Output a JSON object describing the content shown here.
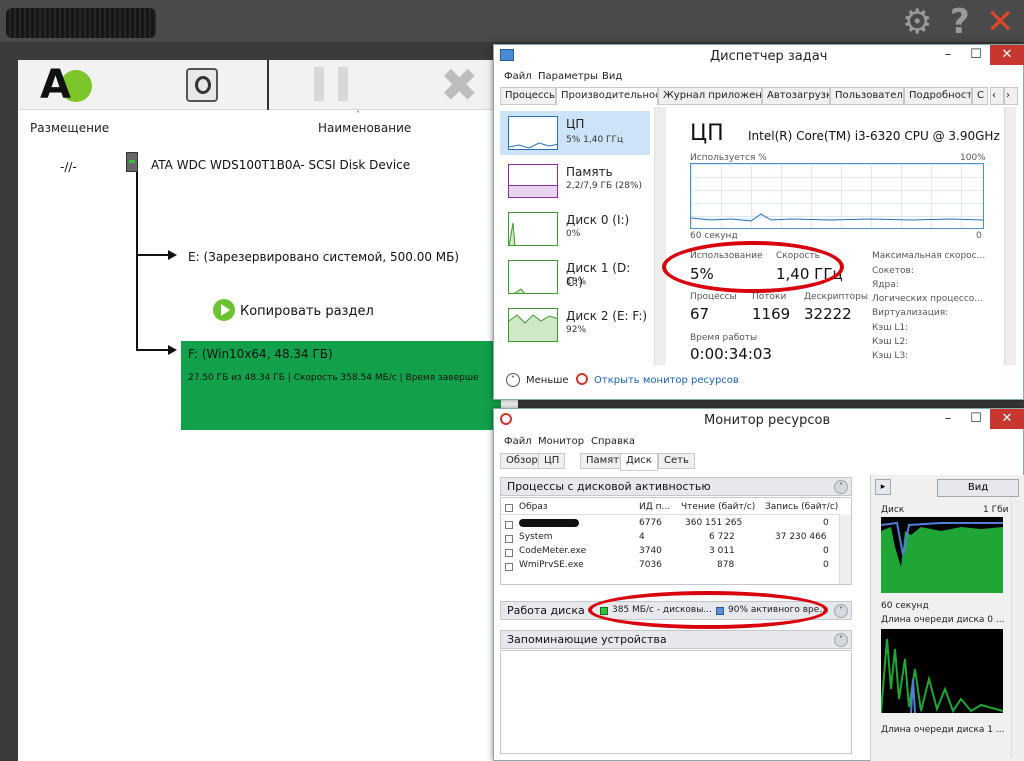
{
  "topbar": {
    "icons": [
      "gear-icon",
      "help-icon",
      "close-icon"
    ],
    "gear": "⚙",
    "help": "?",
    "close": "✕"
  },
  "app": {
    "columns": {
      "placement": "Размещение",
      "name": "Наименование"
    },
    "placement_value": "-//-",
    "disk": "ATA WDC WDS100T1B0A- SCSI Disk Device",
    "partition_e": "E: (Зарезервировано системой, 500.00 МБ)",
    "copy_action": "Копировать раздел",
    "partition_f": "F: (Win10x64, 48.34 ГБ)",
    "progress": "27.50 ГБ из 48.34 ГБ | Скорость 358.54 МБ/с | Время заверше",
    "logo_letter": "A",
    "accent": "#12a14a"
  },
  "taskmgr": {
    "title": "Диспетчер задач",
    "menu": [
      "Файл",
      "Параметры",
      "Вид"
    ],
    "tabs": [
      "Процессы",
      "Производительность",
      "Журнал приложений",
      "Автозагрузка",
      "Пользователи",
      "Подробности",
      "С"
    ],
    "active_tab": "Производительность",
    "sidebar": [
      {
        "name": "ЦП",
        "sub": "5% 1,40 ГГц"
      },
      {
        "name": "Память",
        "sub": "2,2/7,9 ГБ (28%)"
      },
      {
        "name": "Диск 0 (I:)",
        "sub": "0%"
      },
      {
        "name": "Диск 1 (D: C:)",
        "sub": "18%"
      },
      {
        "name": "Диск 2 (E: F:)",
        "sub": "92%"
      }
    ],
    "cpu_title": "ЦП",
    "cpu_model": "Intel(R) Core(TM) i3-6320 CPU @ 3.90GHz",
    "graph_label_left": "Используется %",
    "graph_label_right": "100%",
    "graph_time": "60 секунд",
    "graph_zero": "0",
    "usage_label": "Использование",
    "usage_value": "5%",
    "speed_label": "Скорость",
    "speed_value": "1,40 ГГц",
    "processes_label": "Процессы",
    "processes_value": "67",
    "threads_label": "Потоки",
    "threads_value": "1169",
    "handles_label": "Дескрипторы",
    "handles_value": "32222",
    "uptime_label": "Время работы",
    "uptime_value": "0:00:34:03",
    "right_labels": [
      "Максимальная скорос...",
      "Сокетов:",
      "Ядра:",
      "Логических процессо...",
      "Виртуализация:",
      "Кэш L1:",
      "Кэш L2:",
      "Кэш L3:"
    ],
    "less": "Меньше",
    "open_monitor": "Открыть монитор ресурсов"
  },
  "resmon": {
    "title": "Монитор ресурсов",
    "menu": [
      "Файл",
      "Монитор",
      "Справка"
    ],
    "tabs": [
      "Обзор",
      "ЦП",
      "Память",
      "Диск",
      "Сеть"
    ],
    "active_tab": "Диск",
    "disk_proc_header": "Процессы с дисковой активностью",
    "columns": [
      "Образ",
      "ИД п...",
      "Чтение (байт/с)",
      "Запись (байт/с)"
    ],
    "rows": [
      {
        "image": "",
        "pid": "6776",
        "read": "360 151 265",
        "write": "0"
      },
      {
        "image": "System",
        "pid": "4",
        "read": "6 722",
        "write": "37 230 466"
      },
      {
        "image": "CodeMeter.exe",
        "pid": "3740",
        "read": "3 011",
        "write": "0"
      },
      {
        "image": "WmiPrvSE.exe",
        "pid": "7036",
        "read": "878",
        "write": "0"
      }
    ],
    "disk_work_header": "Работа диска",
    "disk_work_a": "385 МБ/с - дисковы...",
    "disk_work_b": "90% активного вре...",
    "storage_header": "Запоминающие устройства",
    "view_button": "Вид",
    "disk_label": "Диск",
    "disk_rate": "1 Гби",
    "seconds": "60 секунд",
    "queue_a": "Длина очереди диска 0 ...",
    "queue_b": "Длина очереди диска 1 ..."
  }
}
